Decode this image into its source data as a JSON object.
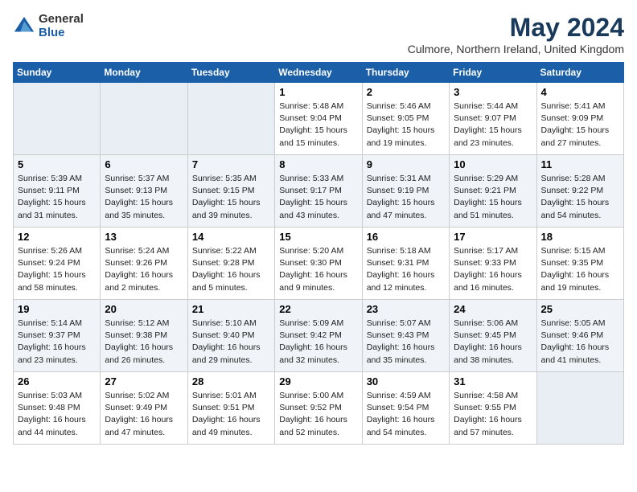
{
  "header": {
    "logo_general": "General",
    "logo_blue": "Blue",
    "title": "May 2024",
    "subtitle": "Culmore, Northern Ireland, United Kingdom"
  },
  "weekdays": [
    "Sunday",
    "Monday",
    "Tuesday",
    "Wednesday",
    "Thursday",
    "Friday",
    "Saturday"
  ],
  "weeks": [
    [
      {
        "day": "",
        "info": ""
      },
      {
        "day": "",
        "info": ""
      },
      {
        "day": "",
        "info": ""
      },
      {
        "day": "1",
        "info": "Sunrise: 5:48 AM\nSunset: 9:04 PM\nDaylight: 15 hours\nand 15 minutes."
      },
      {
        "day": "2",
        "info": "Sunrise: 5:46 AM\nSunset: 9:05 PM\nDaylight: 15 hours\nand 19 minutes."
      },
      {
        "day": "3",
        "info": "Sunrise: 5:44 AM\nSunset: 9:07 PM\nDaylight: 15 hours\nand 23 minutes."
      },
      {
        "day": "4",
        "info": "Sunrise: 5:41 AM\nSunset: 9:09 PM\nDaylight: 15 hours\nand 27 minutes."
      }
    ],
    [
      {
        "day": "5",
        "info": "Sunrise: 5:39 AM\nSunset: 9:11 PM\nDaylight: 15 hours\nand 31 minutes."
      },
      {
        "day": "6",
        "info": "Sunrise: 5:37 AM\nSunset: 9:13 PM\nDaylight: 15 hours\nand 35 minutes."
      },
      {
        "day": "7",
        "info": "Sunrise: 5:35 AM\nSunset: 9:15 PM\nDaylight: 15 hours\nand 39 minutes."
      },
      {
        "day": "8",
        "info": "Sunrise: 5:33 AM\nSunset: 9:17 PM\nDaylight: 15 hours\nand 43 minutes."
      },
      {
        "day": "9",
        "info": "Sunrise: 5:31 AM\nSunset: 9:19 PM\nDaylight: 15 hours\nand 47 minutes."
      },
      {
        "day": "10",
        "info": "Sunrise: 5:29 AM\nSunset: 9:21 PM\nDaylight: 15 hours\nand 51 minutes."
      },
      {
        "day": "11",
        "info": "Sunrise: 5:28 AM\nSunset: 9:22 PM\nDaylight: 15 hours\nand 54 minutes."
      }
    ],
    [
      {
        "day": "12",
        "info": "Sunrise: 5:26 AM\nSunset: 9:24 PM\nDaylight: 15 hours\nand 58 minutes."
      },
      {
        "day": "13",
        "info": "Sunrise: 5:24 AM\nSunset: 9:26 PM\nDaylight: 16 hours\nand 2 minutes."
      },
      {
        "day": "14",
        "info": "Sunrise: 5:22 AM\nSunset: 9:28 PM\nDaylight: 16 hours\nand 5 minutes."
      },
      {
        "day": "15",
        "info": "Sunrise: 5:20 AM\nSunset: 9:30 PM\nDaylight: 16 hours\nand 9 minutes."
      },
      {
        "day": "16",
        "info": "Sunrise: 5:18 AM\nSunset: 9:31 PM\nDaylight: 16 hours\nand 12 minutes."
      },
      {
        "day": "17",
        "info": "Sunrise: 5:17 AM\nSunset: 9:33 PM\nDaylight: 16 hours\nand 16 minutes."
      },
      {
        "day": "18",
        "info": "Sunrise: 5:15 AM\nSunset: 9:35 PM\nDaylight: 16 hours\nand 19 minutes."
      }
    ],
    [
      {
        "day": "19",
        "info": "Sunrise: 5:14 AM\nSunset: 9:37 PM\nDaylight: 16 hours\nand 23 minutes."
      },
      {
        "day": "20",
        "info": "Sunrise: 5:12 AM\nSunset: 9:38 PM\nDaylight: 16 hours\nand 26 minutes."
      },
      {
        "day": "21",
        "info": "Sunrise: 5:10 AM\nSunset: 9:40 PM\nDaylight: 16 hours\nand 29 minutes."
      },
      {
        "day": "22",
        "info": "Sunrise: 5:09 AM\nSunset: 9:42 PM\nDaylight: 16 hours\nand 32 minutes."
      },
      {
        "day": "23",
        "info": "Sunrise: 5:07 AM\nSunset: 9:43 PM\nDaylight: 16 hours\nand 35 minutes."
      },
      {
        "day": "24",
        "info": "Sunrise: 5:06 AM\nSunset: 9:45 PM\nDaylight: 16 hours\nand 38 minutes."
      },
      {
        "day": "25",
        "info": "Sunrise: 5:05 AM\nSunset: 9:46 PM\nDaylight: 16 hours\nand 41 minutes."
      }
    ],
    [
      {
        "day": "26",
        "info": "Sunrise: 5:03 AM\nSunset: 9:48 PM\nDaylight: 16 hours\nand 44 minutes."
      },
      {
        "day": "27",
        "info": "Sunrise: 5:02 AM\nSunset: 9:49 PM\nDaylight: 16 hours\nand 47 minutes."
      },
      {
        "day": "28",
        "info": "Sunrise: 5:01 AM\nSunset: 9:51 PM\nDaylight: 16 hours\nand 49 minutes."
      },
      {
        "day": "29",
        "info": "Sunrise: 5:00 AM\nSunset: 9:52 PM\nDaylight: 16 hours\nand 52 minutes."
      },
      {
        "day": "30",
        "info": "Sunrise: 4:59 AM\nSunset: 9:54 PM\nDaylight: 16 hours\nand 54 minutes."
      },
      {
        "day": "31",
        "info": "Sunrise: 4:58 AM\nSunset: 9:55 PM\nDaylight: 16 hours\nand 57 minutes."
      },
      {
        "day": "",
        "info": ""
      }
    ]
  ]
}
